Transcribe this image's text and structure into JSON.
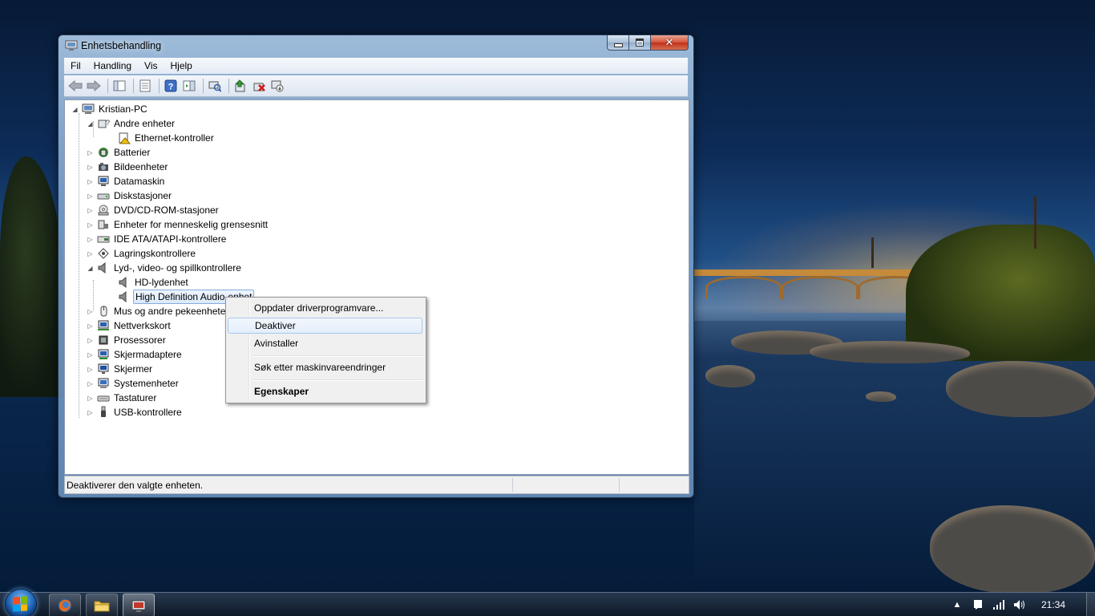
{
  "window": {
    "title": "Enhetsbehandling",
    "close_glyph": "✕"
  },
  "menubar": [
    "Fil",
    "Handling",
    "Vis",
    "Hjelp"
  ],
  "tree": {
    "root": "Kristian-PC",
    "items": [
      {
        "label": "Andre enheter",
        "expanded": true,
        "icon": "unknown-device-icon"
      },
      {
        "label": "Ethernet-kontroller",
        "child": true,
        "icon": "warning-device-icon"
      },
      {
        "label": "Batterier",
        "icon": "battery-icon"
      },
      {
        "label": "Bildeenheter",
        "icon": "camera-icon"
      },
      {
        "label": "Datamaskin",
        "icon": "computer-icon"
      },
      {
        "label": "Diskstasjoner",
        "icon": "disk-drive-icon"
      },
      {
        "label": "DVD/CD-ROM-stasjoner",
        "icon": "optical-drive-icon"
      },
      {
        "label": "Enheter for menneskelig grensesnitt",
        "icon": "hid-icon"
      },
      {
        "label": "IDE ATA/ATAPI-kontrollere",
        "icon": "ide-controller-icon"
      },
      {
        "label": "Lagringskontrollere",
        "icon": "storage-controller-icon"
      },
      {
        "label": "Lyd-, video- og spillkontrollere",
        "expanded": true,
        "icon": "speaker-icon"
      },
      {
        "label": "HD-lydenhet",
        "child": true,
        "icon": "speaker-icon"
      },
      {
        "label": "High Definition Audio-enhet",
        "child": true,
        "selected": true,
        "icon": "speaker-icon"
      },
      {
        "label": "Mus og andre pekeenheter",
        "icon": "mouse-icon"
      },
      {
        "label": "Nettverkskort",
        "icon": "network-adapter-icon"
      },
      {
        "label": "Prosessorer",
        "icon": "processor-icon"
      },
      {
        "label": "Skjermadaptere",
        "icon": "display-adapter-icon"
      },
      {
        "label": "Skjermer",
        "icon": "monitor-icon"
      },
      {
        "label": "Systemenheter",
        "icon": "system-device-icon"
      },
      {
        "label": "Tastaturer",
        "icon": "keyboard-icon"
      },
      {
        "label": "USB-kontrollere",
        "icon": "usb-icon"
      }
    ]
  },
  "context_menu": {
    "items": [
      {
        "label": "Oppdater driverprogramvare...",
        "bold": false
      },
      {
        "label": "Deaktiver",
        "bold": false,
        "hover": true
      },
      {
        "label": "Avinstaller",
        "bold": false
      },
      {
        "label": "Søk etter maskinvareendringer",
        "bold": false
      },
      {
        "label": "Egenskaper",
        "bold": true
      }
    ]
  },
  "statusbar": {
    "text": "Deaktiverer den valgte enheten."
  },
  "taskbar": {
    "clock": "21:34",
    "apps": [
      "firefox-icon",
      "explorer-folder-icon",
      "device-manager-icon"
    ]
  },
  "colors": {
    "selection_border": "#84acdd",
    "close_button": "#c0301a",
    "taskbar": "#1c2a3c"
  }
}
